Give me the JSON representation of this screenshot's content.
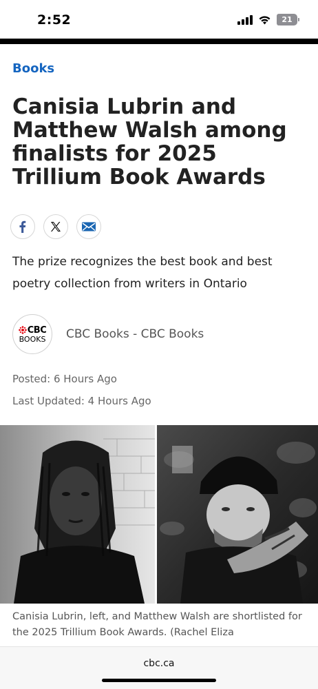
{
  "status_bar": {
    "time": "2:52",
    "battery_level": "21",
    "battery_percent": 21
  },
  "article": {
    "section": "Books",
    "headline": "Canisia Lubrin and Matthew Walsh among finalists for 2025 Trillium Book Awards",
    "share_icons": [
      "facebook-icon",
      "x-icon",
      "email-icon"
    ],
    "dek": "The prize recognizes the best book and best poetry collection from writers in Ontario",
    "byline": {
      "logo_top": "CBC",
      "logo_bottom": "BOOKS",
      "author": "CBC Books - CBC Books"
    },
    "posted": "Posted: 6 Hours Ago",
    "updated": "Last Updated: 4 Hours Ago",
    "caption": "Canisia Lubrin, left, and Matthew Walsh are shortlisted for the 2025 Trillium Book Awards. (Rachel Eliza"
  },
  "browser": {
    "url": "cbc.ca"
  },
  "colors": {
    "link": "#1565c0",
    "facebook": "#3b5998",
    "email": "#1a66b2",
    "cbc_red": "#e50914"
  }
}
